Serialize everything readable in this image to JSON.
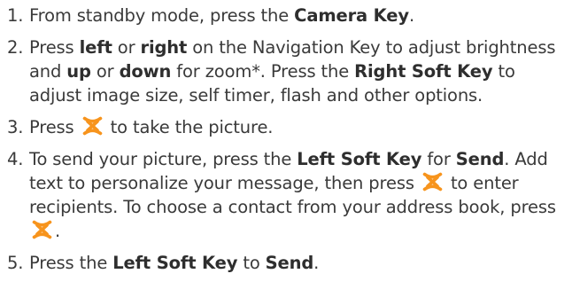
{
  "steps": [
    {
      "number": "1.",
      "parts": {
        "t1": "From standby mode, press the ",
        "b1": "Camera Key",
        "t2": "."
      }
    },
    {
      "number": "2.",
      "parts": {
        "t1": "Press ",
        "b1": "left",
        "t2": " or ",
        "b2": "right",
        "t3": " on the Navigation Key to adjust brightness and ",
        "b3": "up",
        "t4": " or ",
        "b4": "down",
        "t5": " for zoom*. Press the ",
        "b5": "Right Soft Key",
        "t6": " to adjust image size, self timer, flash and other options."
      }
    },
    {
      "number": "3.",
      "parts": {
        "t1": "Press ",
        "t2": " to take the picture."
      }
    },
    {
      "number": "4.",
      "parts": {
        "t1": "To send your picture, press the ",
        "b1": "Left Soft Key",
        "t2": " for ",
        "b2": "Send",
        "t3": ". Add text to personalize your message, then press ",
        "t4": " to enter recipients. To choose a contact from your address book, press ",
        "t5": "."
      }
    },
    {
      "number": "5.",
      "parts": {
        "t1": "Press the ",
        "b1": "Left Soft Key",
        "t2": " to ",
        "b2": "Send",
        "t3": "."
      }
    }
  ],
  "icon": {
    "name": "ok-key-icon",
    "color": "#f7941d"
  }
}
